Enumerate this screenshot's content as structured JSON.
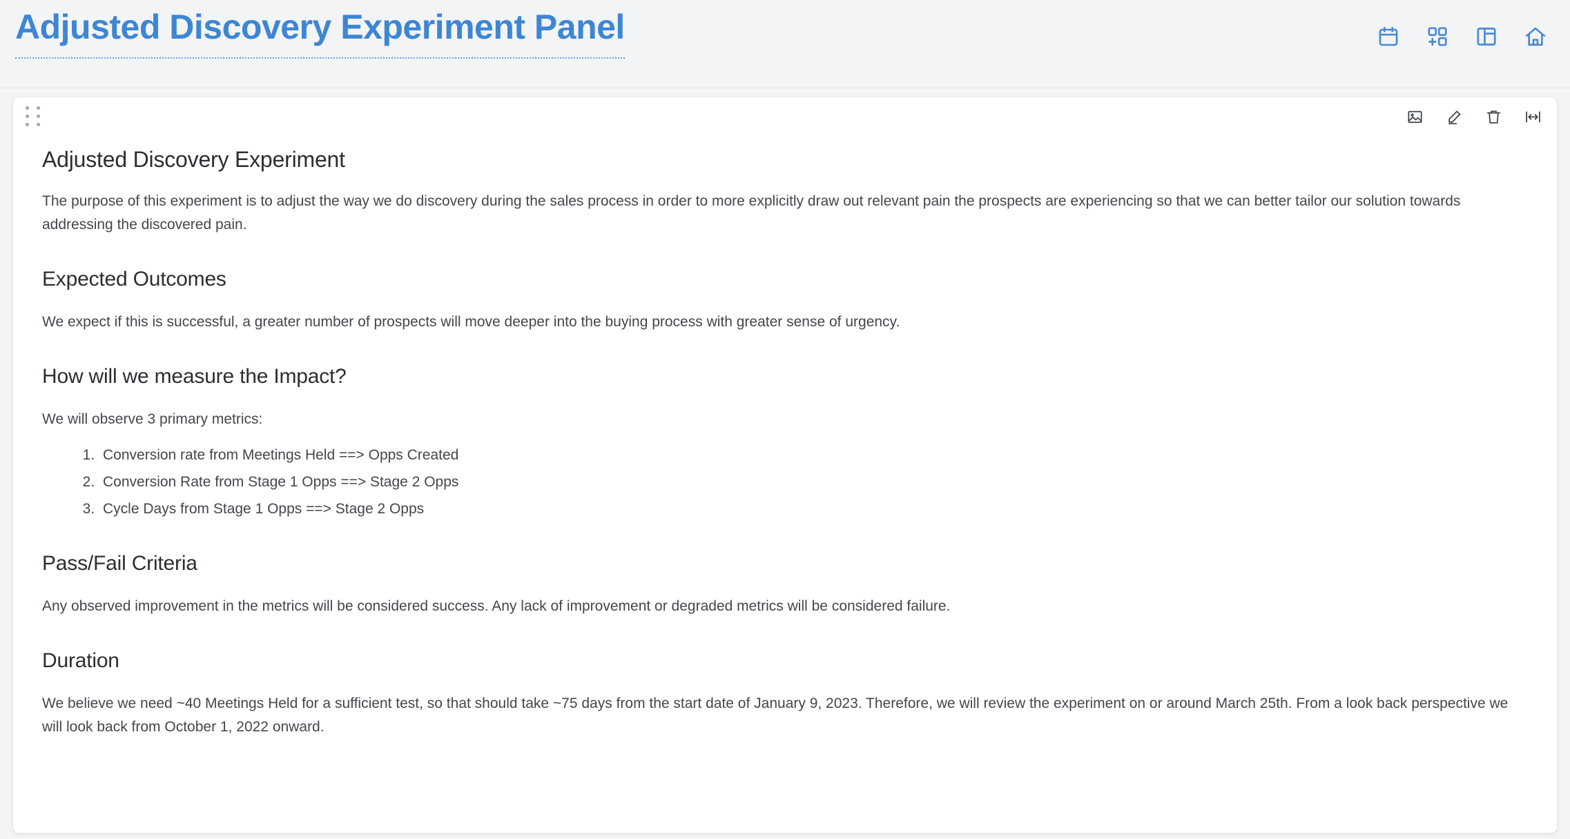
{
  "header": {
    "title": "Adjusted Discovery Experiment Panel",
    "icons": [
      {
        "name": "calendar-icon",
        "label": "Calendar"
      },
      {
        "name": "layout-grid-add-icon",
        "label": "Add widget"
      },
      {
        "name": "layout-sidebar-icon",
        "label": "Layout"
      },
      {
        "name": "home-icon",
        "label": "Home"
      }
    ]
  },
  "card": {
    "drag_handle_label": "Drag panel",
    "actions": [
      {
        "name": "image-icon",
        "label": "Insert image"
      },
      {
        "name": "edit-pencil-icon",
        "label": "Edit"
      },
      {
        "name": "trash-icon",
        "label": "Delete"
      },
      {
        "name": "arrows-horizontal-icon",
        "label": "Resize"
      }
    ]
  },
  "document": {
    "heading": "Adjusted Discovery Experiment",
    "intro": "The purpose of this experiment is to adjust the way we do discovery during the sales process in order to more explicitly draw out relevant pain the prospects are experiencing so that we can better tailor our solution towards addressing the discovered pain.",
    "sections": [
      {
        "heading": "Expected Outcomes",
        "body": "We expect if this is successful, a greater number of prospects will move deeper into the buying process with greater sense of urgency."
      },
      {
        "heading": "How will we measure the Impact?",
        "body": "We will observe 3 primary metrics:",
        "list": [
          "Conversion rate from Meetings Held ==> Opps Created",
          "Conversion Rate from Stage 1 Opps ==> Stage 2 Opps",
          "Cycle Days from Stage 1 Opps ==> Stage 2 Opps"
        ]
      },
      {
        "heading": "Pass/Fail Criteria",
        "body": "Any observed improvement in the metrics will be considered success. Any lack of improvement or degraded metrics will be considered failure."
      },
      {
        "heading": "Duration",
        "body": "We believe we need ~40 Meetings Held for a sufficient test, so that should take ~75 days from the start date of January 9, 2023. Therefore, we will review the experiment on or around March 25th. From a look back perspective we will look back from October 1, 2022 onward."
      }
    ]
  },
  "colors": {
    "accent": "#3d86d4",
    "page_background": "#f3f4f6",
    "card_background": "#ffffff",
    "heading_text": "#2b2e33",
    "body_text": "#42464d"
  }
}
